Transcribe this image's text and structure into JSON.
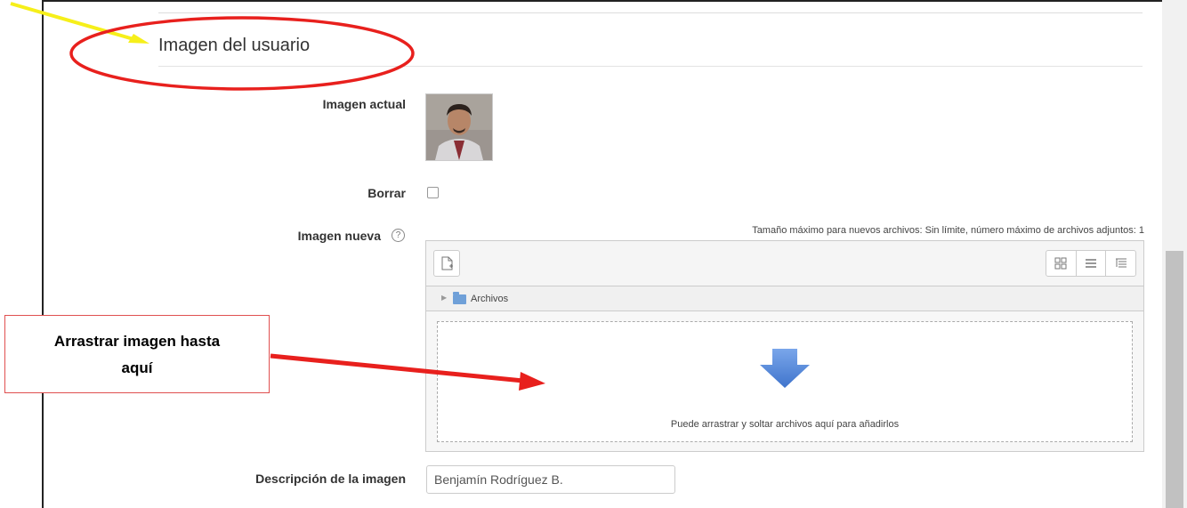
{
  "section": {
    "title": "Imagen del usuario"
  },
  "fields": {
    "current_image_label": "Imagen actual",
    "delete_label": "Borrar",
    "new_image_label": "Imagen nueva",
    "description_label": "Descripción de la imagen",
    "description_value": "Benjamín Rodríguez B."
  },
  "filepicker": {
    "max_info": "Tamaño máximo para nuevos archivos: Sin límite, número máximo de archivos adjuntos: 1",
    "path_folder": "Archivos",
    "drop_text": "Puede arrastrar y soltar archivos aquí para añadirlos"
  },
  "callout": {
    "line1": "Arrastrar imagen hasta",
    "line2": "aquí"
  },
  "icons": {
    "help": "question-circle-icon",
    "add_file": "add-file-icon",
    "views": [
      "grid-view-icon",
      "list-view-icon",
      "tree-view-icon"
    ]
  },
  "colors": {
    "annotation_red": "#e8201d",
    "annotation_yellow": "#f6ef1a",
    "drop_arrow": "#5b8fde"
  }
}
